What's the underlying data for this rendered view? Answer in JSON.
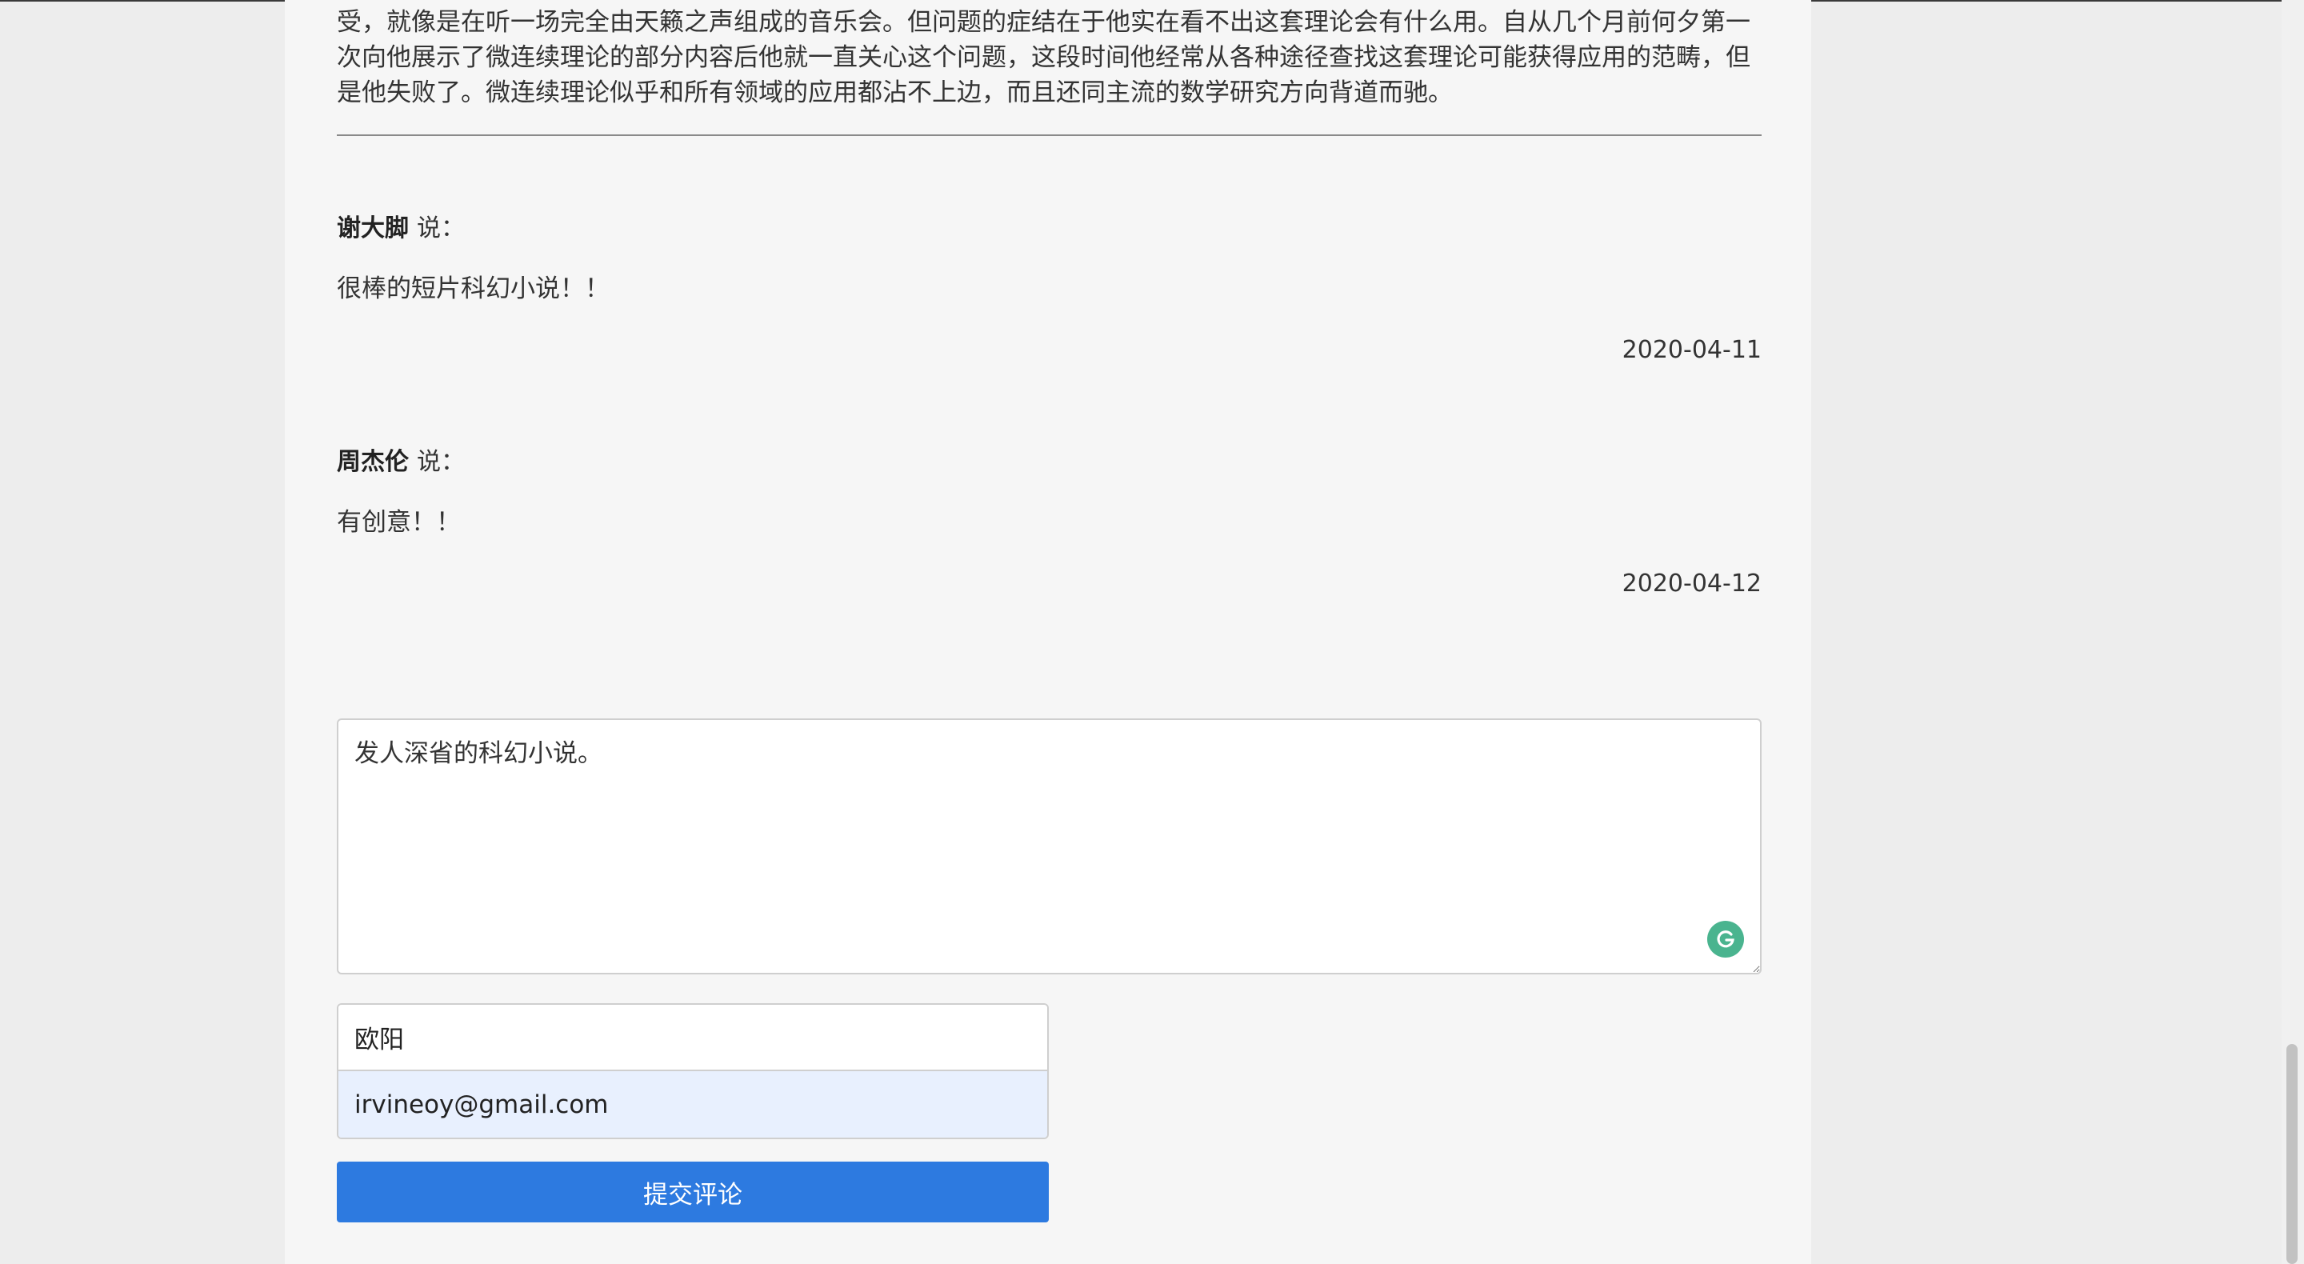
{
  "article": {
    "tail_text": "受，就像是在听一场完全由天籁之声组成的音乐会。但问题的症结在于他实在看不出这套理论会有什么用。自从几个月前何夕第一次向他展示了微连续理论的部分内容后他就一直关心这个问题，这段时间他经常从各种途径查找这套理论可能获得应用的范畴，但是他失败了。微连续理论似乎和所有领域的应用都沾不上边，而且还同主流的数学研究方向背道而驰。"
  },
  "comments": [
    {
      "author": "谢大脚",
      "says": "说：",
      "body": "很棒的短片科幻小说！！",
      "date": "2020-04-11"
    },
    {
      "author": "周杰伦",
      "says": "说：",
      "body": "有创意！！",
      "date": "2020-04-12"
    }
  ],
  "form": {
    "comment_value": "发人深省的科幻小说。",
    "name_value": "欧阳",
    "email_value": "irvineoy@gmail.com",
    "submit_label": "提交评论",
    "grammarly_icon": "grammarly-icon"
  },
  "colors": {
    "submit_bg": "#2d7ae0",
    "email_autofill_bg": "#e8f0fe",
    "grammarly": "#4ab48f"
  }
}
